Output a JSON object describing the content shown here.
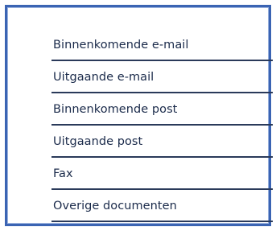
{
  "menu": {
    "items": [
      {
        "label": "Binnenkomende e-mail"
      },
      {
        "label": "Uitgaande e-mail"
      },
      {
        "label": "Binnenkomende post"
      },
      {
        "label": "Uitgaande post"
      },
      {
        "label": "Fax"
      },
      {
        "label": "Overige documenten"
      }
    ]
  },
  "colors": {
    "frame_border": "#3b64b3",
    "text": "#1a2a4a",
    "rule": "#2a3a5a",
    "background": "#ffffff"
  }
}
